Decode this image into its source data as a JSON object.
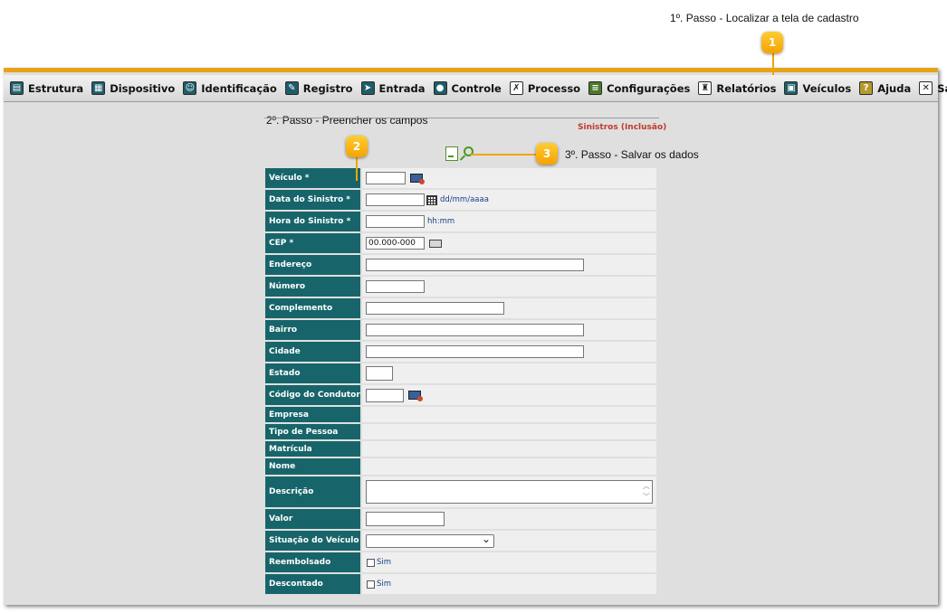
{
  "annotations": {
    "step1": {
      "badge": "1",
      "text": "1º. Passo - Localizar a tela de cadastro"
    },
    "step2": {
      "badge": "2",
      "text": "2º. Passo - Preencher os campos"
    },
    "step3": {
      "badge": "3",
      "text": "3º. Passo - Salvar os dados"
    }
  },
  "menu": [
    {
      "label": "Estrutura",
      "icon": "structure-icon"
    },
    {
      "label": "Dispositivo",
      "icon": "device-icon"
    },
    {
      "label": "Identificação",
      "icon": "identification-icon"
    },
    {
      "label": "Registro",
      "icon": "register-icon"
    },
    {
      "label": "Entrada",
      "icon": "entry-icon"
    },
    {
      "label": "Controle",
      "icon": "control-icon"
    },
    {
      "label": "Processo",
      "icon": "process-icon"
    },
    {
      "label": "Configurações",
      "icon": "settings-icon"
    },
    {
      "label": "Relatórios",
      "icon": "reports-icon"
    },
    {
      "label": "Veículos",
      "icon": "vehicle-icon"
    },
    {
      "label": "Ajuda",
      "icon": "help-icon"
    },
    {
      "label": "Sair",
      "icon": "exit-icon"
    }
  ],
  "form": {
    "title": "Sinistros (Inclusão)",
    "fields": {
      "veiculo": {
        "label": "Veículo *",
        "value": ""
      },
      "data_sinistro": {
        "label": "Data do Sinistro *",
        "value": "",
        "hint": "dd/mm/aaaa"
      },
      "hora_sinistro": {
        "label": "Hora do Sinistro *",
        "value": "",
        "hint": "hh:mm"
      },
      "cep": {
        "label": "CEP *",
        "value": "00.000-000"
      },
      "endereco": {
        "label": "Endereço",
        "value": ""
      },
      "numero": {
        "label": "Número",
        "value": ""
      },
      "complemento": {
        "label": "Complemento",
        "value": ""
      },
      "bairro": {
        "label": "Bairro",
        "value": ""
      },
      "cidade": {
        "label": "Cidade",
        "value": ""
      },
      "estado": {
        "label": "Estado",
        "value": ""
      },
      "codigo_condutor": {
        "label": "Código do Condutor *",
        "value": ""
      },
      "empresa": {
        "label": "Empresa",
        "value": ""
      },
      "tipo_pessoa": {
        "label": "Tipo de Pessoa",
        "value": ""
      },
      "matricula": {
        "label": "Matrícula",
        "value": ""
      },
      "nome": {
        "label": "Nome",
        "value": ""
      },
      "descricao": {
        "label": "Descrição",
        "value": ""
      },
      "valor": {
        "label": "Valor",
        "value": ""
      },
      "situacao_veiculo": {
        "label": "Situação do Veículo",
        "value": ""
      },
      "reembolsado": {
        "label": "Reembolsado",
        "option": "Sim"
      },
      "descontado": {
        "label": "Descontado",
        "option": "Sim"
      }
    }
  }
}
